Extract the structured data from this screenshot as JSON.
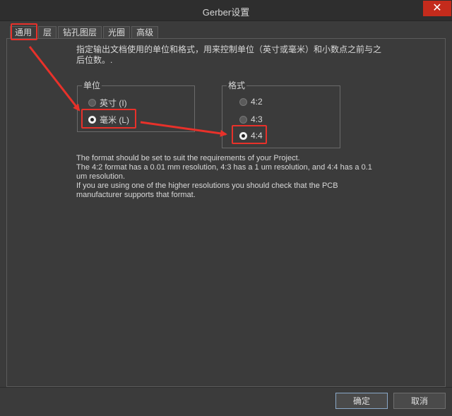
{
  "window": {
    "title": "Gerber设置",
    "close_glyph": "✕"
  },
  "tabs": [
    {
      "label": "通用",
      "active": true
    },
    {
      "label": "层",
      "active": false
    },
    {
      "label": "钻孔图层",
      "active": false
    },
    {
      "label": "光圈",
      "active": false
    },
    {
      "label": "高级",
      "active": false
    }
  ],
  "description": "指定输出文档使用的单位和格式，用来控制单位（英寸或毫米）和小数点之前与之后位数。.",
  "units": {
    "legend": "单位",
    "options": [
      {
        "label": "英寸 (I)",
        "checked": false
      },
      {
        "label": "毫米 (L)",
        "checked": true
      }
    ]
  },
  "format": {
    "legend": "格式",
    "options": [
      {
        "label": "4:2",
        "checked": false
      },
      {
        "label": "4:3",
        "checked": false
      },
      {
        "label": "4:4",
        "checked": true
      }
    ]
  },
  "info": {
    "line1": "The format should be set to suit the requirements of your Project.",
    "line2": "The 4:2 format has a 0.01 mm resolution, 4:3 has a 1 um resolution, and 4:4 has a 0.1 um resolution.",
    "line3": "If you are using one of the higher resolutions you should check that the PCB manufacturer supports that format."
  },
  "buttons": {
    "ok": "确定",
    "cancel": "取消"
  },
  "colors": {
    "annotation": "#e8312a",
    "close": "#c42b1c"
  }
}
